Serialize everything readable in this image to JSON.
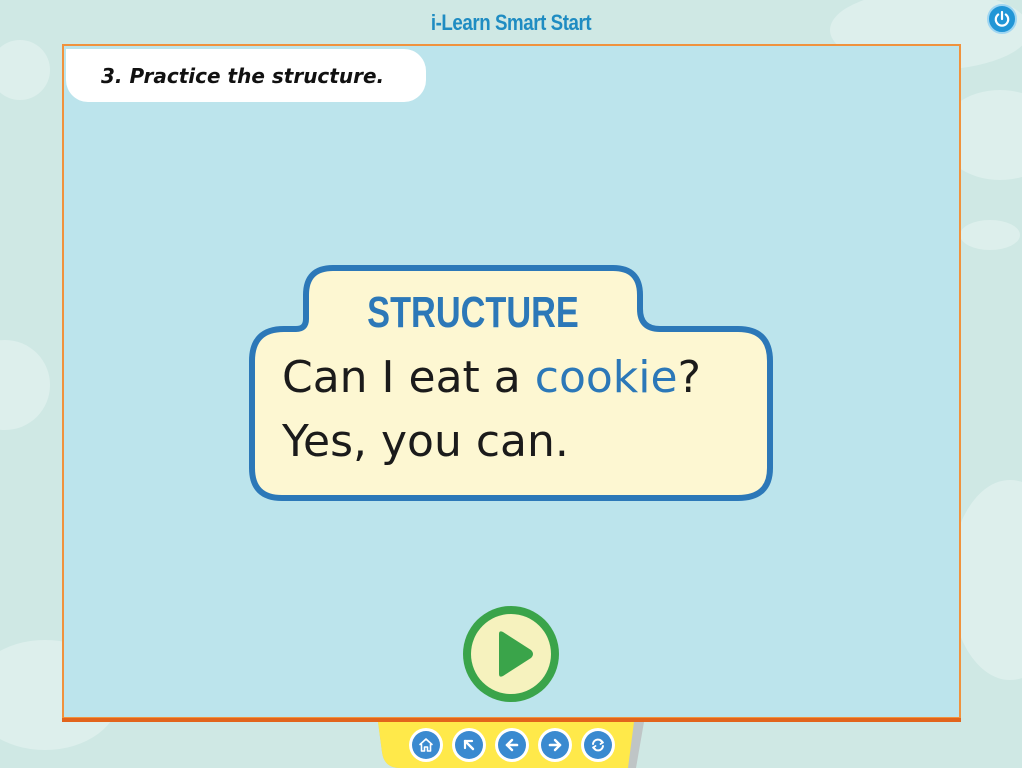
{
  "app": {
    "title": "i-Learn Smart Start"
  },
  "instruction": {
    "text": "3. Practice the structure."
  },
  "structure": {
    "heading": "STRUCTURE",
    "line1_before": "Can I eat a ",
    "line1_highlight": "cookie",
    "line1_after": "?",
    "line2": "Yes, you can."
  },
  "nav": {
    "buttons": [
      "home-icon",
      "back-to-start-icon",
      "previous-icon",
      "next-icon",
      "refresh-icon"
    ]
  },
  "colors": {
    "stage_bg": "#bce4ec",
    "stage_border": "#f0923d",
    "card_fill": "#fdf7d2",
    "card_stroke": "#2c78b8",
    "play_green": "#3aa44a",
    "nav_yellow": "#ffe94a"
  }
}
